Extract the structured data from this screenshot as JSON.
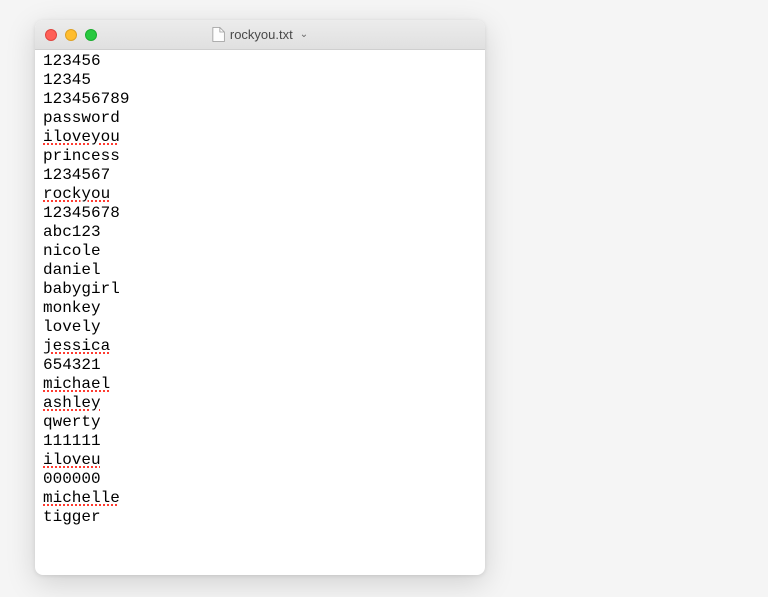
{
  "window": {
    "title": "rockyou.txt"
  },
  "lines": [
    {
      "text": "123456",
      "misspelled": false
    },
    {
      "text": "12345",
      "misspelled": false
    },
    {
      "text": "123456789",
      "misspelled": false
    },
    {
      "text": "password",
      "misspelled": false
    },
    {
      "text": "iloveyou",
      "misspelled": true
    },
    {
      "text": "princess",
      "misspelled": false
    },
    {
      "text": "1234567",
      "misspelled": false
    },
    {
      "text": "rockyou",
      "misspelled": true
    },
    {
      "text": "12345678",
      "misspelled": false
    },
    {
      "text": "abc123",
      "misspelled": false
    },
    {
      "text": "nicole",
      "misspelled": false
    },
    {
      "text": "daniel",
      "misspelled": false
    },
    {
      "text": "babygirl",
      "misspelled": false
    },
    {
      "text": "monkey",
      "misspelled": false
    },
    {
      "text": "lovely",
      "misspelled": false
    },
    {
      "text": "jessica",
      "misspelled": true
    },
    {
      "text": "654321",
      "misspelled": false
    },
    {
      "text": "michael",
      "misspelled": true
    },
    {
      "text": "ashley",
      "misspelled": true
    },
    {
      "text": "qwerty",
      "misspelled": false
    },
    {
      "text": "111111",
      "misspelled": false
    },
    {
      "text": "iloveu",
      "misspelled": true
    },
    {
      "text": "000000",
      "misspelled": false
    },
    {
      "text": "michelle",
      "misspelled": true
    },
    {
      "text": "tigger",
      "misspelled": false
    }
  ]
}
